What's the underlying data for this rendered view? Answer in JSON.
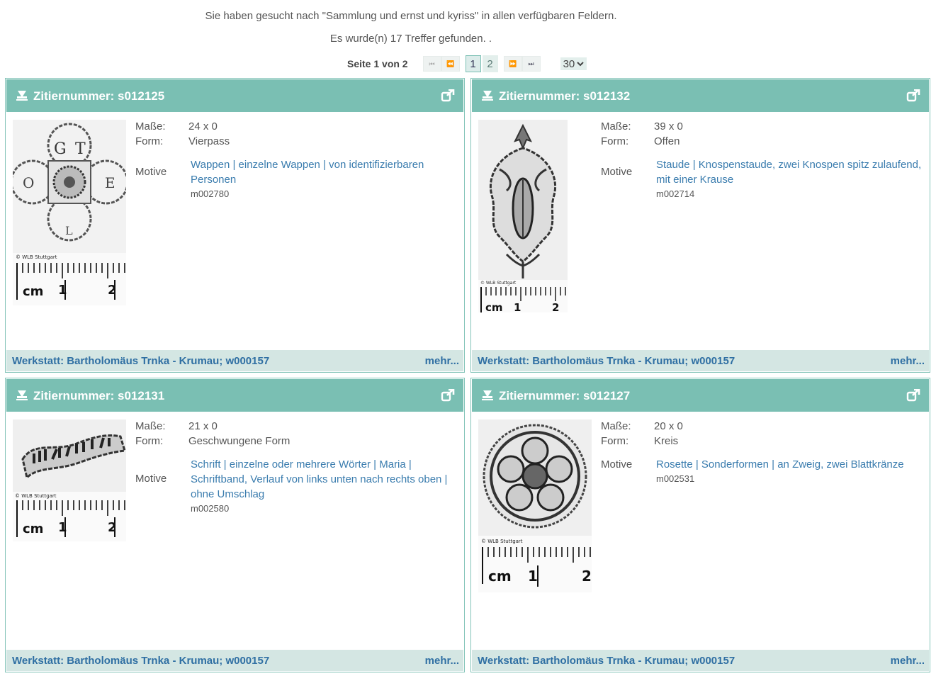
{
  "search": {
    "query_text": "Sie haben gesucht nach \"Sammlung und ernst und kyriss\" in allen verfügbaren Feldern.",
    "result_text": "Es wurde(n) 17 Treffer gefunden. ."
  },
  "pagination": {
    "label": "Seite 1 von 2",
    "pages": [
      "1",
      "2"
    ],
    "current": "1",
    "page_size": "30",
    "icons": [
      "first-page-icon",
      "prev-page-icon",
      "next-page-icon",
      "last-page-icon"
    ]
  },
  "labels": {
    "masse": "Maße:",
    "form": "Form:",
    "motive": "Motive",
    "more": "mehr..."
  },
  "colors": {
    "header": "#7abfb3",
    "footer": "#d4e6e3",
    "link": "#3a7cae"
  },
  "cards": [
    {
      "title": "Zitiernummer: s012125",
      "masse": "24 x 0",
      "form": "Vierpass",
      "motive_links": "Wappen | einzelne Wappen | von identifizierbaren Personen",
      "motive_code": "m002780",
      "workshop": "Werkstatt: Bartholomäus Trnka - Krumau; w000157",
      "image": "quatrefoil-coat-of-arms-stamp",
      "image_letters": [
        "G",
        "T",
        "O",
        "E",
        "L"
      ],
      "credit": "© WLB Stuttgart"
    },
    {
      "title": "Zitiernummer: s012132",
      "masse": "39 x 0",
      "form": "Offen",
      "motive_links": "Staude | Knospenstaude, zwei Knospen spitz zulaufend, mit einer Krause",
      "motive_code": "m002714",
      "workshop": "Werkstatt: Bartholomäus Trnka - Krumau; w000157",
      "image": "bud-plant-stamp",
      "credit": "© WLB Stuttgart"
    },
    {
      "title": "Zitiernummer: s012131",
      "masse": "21 x 0",
      "form": "Geschwungene Form",
      "motive_links": "Schrift | einzelne oder mehrere Wörter | Maria | Schriftband, Verlauf von links unten nach rechts oben | ohne Umschlag",
      "motive_code": "m002580",
      "workshop": "Werkstatt: Bartholomäus Trnka - Krumau; w000157",
      "image": "scroll-banner-stamp",
      "credit": "© WLB Stuttgart"
    },
    {
      "title": "Zitiernummer: s012127",
      "masse": "20 x 0",
      "form": "Kreis",
      "motive_links": "Rosette | Sonderformen | an Zweig, zwei Blattkränze",
      "motive_code": "m002531",
      "workshop": "Werkstatt: Bartholomäus Trnka - Krumau; w000157",
      "image": "rosette-circle-stamp",
      "credit": "© WLB Stuttgart"
    }
  ],
  "scale": {
    "unit": "cm",
    "marks": [
      "1",
      "2"
    ]
  }
}
